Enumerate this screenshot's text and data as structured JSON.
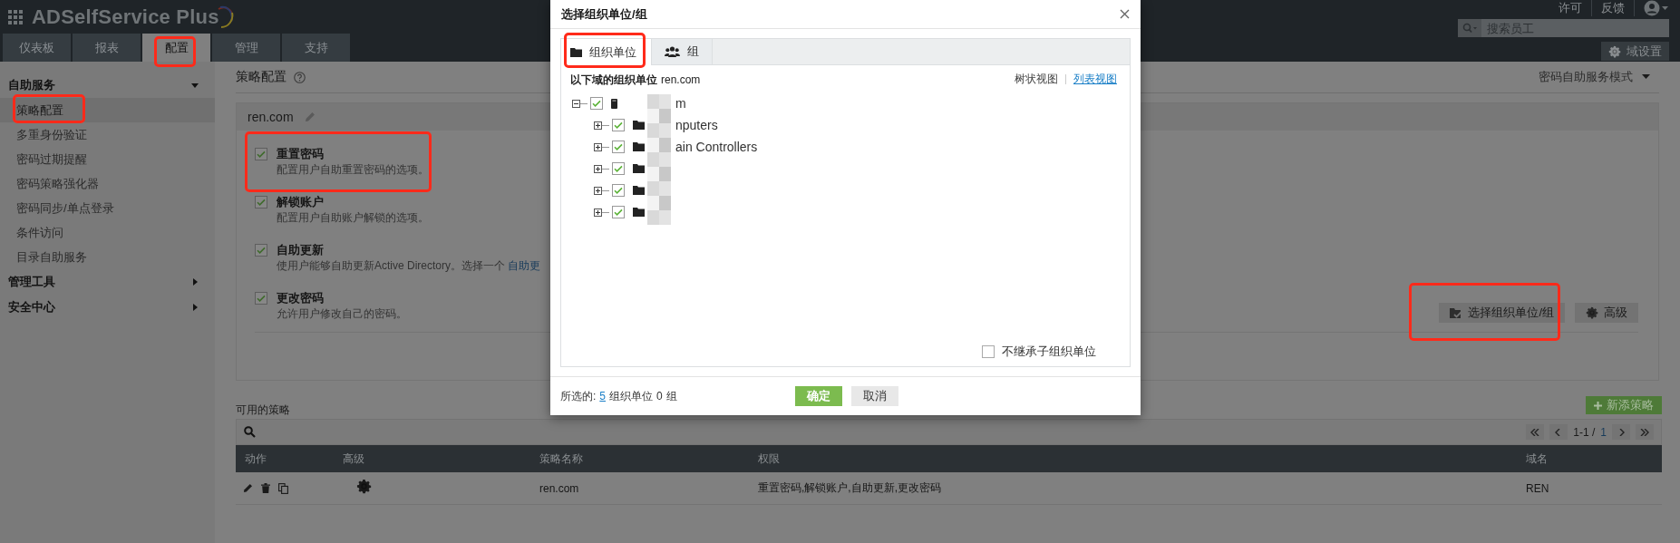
{
  "header": {
    "product": "ADSelfService Plus",
    "links": [
      "许可",
      "反馈"
    ],
    "search": {
      "placeholder": "搜索员工"
    },
    "domain_settings": "域设置"
  },
  "tabs": [
    {
      "label": "仪表板",
      "selected": false
    },
    {
      "label": "报表",
      "selected": false
    },
    {
      "label": "配置",
      "selected": true
    },
    {
      "label": "管理",
      "selected": false
    },
    {
      "label": "支持",
      "selected": false
    }
  ],
  "sidebar": {
    "sections": [
      {
        "label": "自助服务",
        "expanded": true,
        "items": [
          {
            "label": "策略配置",
            "selected": true
          },
          {
            "label": "多重身份验证",
            "selected": false
          },
          {
            "label": "密码过期提醒",
            "selected": false
          },
          {
            "label": "密码策略强化器",
            "selected": false
          },
          {
            "label": "密码同步/单点登录",
            "selected": false
          },
          {
            "label": "条件访问",
            "selected": false
          },
          {
            "label": "目录自助服务",
            "selected": false
          }
        ]
      },
      {
        "label": "管理工具",
        "expanded": false
      },
      {
        "label": "安全中心",
        "expanded": false
      }
    ]
  },
  "policy": {
    "title": "策略配置",
    "mode": "密码自助服务模式",
    "domain": "ren.com",
    "features": [
      {
        "title": "重置密码",
        "description": "配置用户自助重置密码的选项。",
        "checked": true
      },
      {
        "title": "解锁账户",
        "description": "配置用户自助账户解锁的选项。",
        "checked": true
      },
      {
        "title": "自助更新",
        "description": "使用户能够自助更新Active Directory。选择一个 ",
        "link": "自助更",
        "checked": true
      },
      {
        "title": "更改密码",
        "description": "允许用户修改自己的密码。",
        "checked": true
      }
    ],
    "buttons": [
      "选择组织单位/组",
      "高级"
    ]
  },
  "available": {
    "title": "可用的策略",
    "add": "新添策略",
    "page_range": "1-1 /",
    "page_total": "1",
    "columns": [
      "动作",
      "高级",
      "策略名称",
      "权限",
      "域名"
    ],
    "rows": [
      {
        "name": "ren.com",
        "permissions": "重置密码,解锁账户,自助更新,更改密码",
        "domain": "REN"
      }
    ]
  },
  "dialog": {
    "title": "选择组织单位/组",
    "tabs": [
      {
        "label": "组织单位",
        "selected": true,
        "kind": "ou"
      },
      {
        "label": "组",
        "selected": false,
        "kind": "group"
      }
    ],
    "heading": "以下域的组织单位",
    "domain": "ren.com",
    "views": [
      {
        "label": "树状视图",
        "selected": true
      },
      {
        "label": "列表视图",
        "selected": false
      }
    ],
    "tree": [
      {
        "label": "m",
        "kind": "domain",
        "checked": true,
        "expanded": true,
        "children": [
          {
            "label": "nputers",
            "kind": "folder",
            "checked": true,
            "expanded": false
          },
          {
            "label": "ain Controllers",
            "kind": "folder",
            "checked": true,
            "expanded": false
          },
          {
            "kind": "folder",
            "checked": true,
            "expanded": false
          },
          {
            "kind": "folder",
            "checked": true,
            "expanded": false
          },
          {
            "kind": "folder",
            "checked": true,
            "expanded": false
          }
        ]
      }
    ],
    "no_inherit": {
      "label": "不继承子组织单位",
      "checked": false
    },
    "selected_label": "所选的:",
    "ou_count": "5",
    "ou_label": "组织单位",
    "group_count": "0",
    "group_label": "组",
    "buttons": [
      {
        "label": "确定",
        "kind": "primary"
      },
      {
        "label": "取消",
        "kind": "secondary"
      }
    ]
  }
}
